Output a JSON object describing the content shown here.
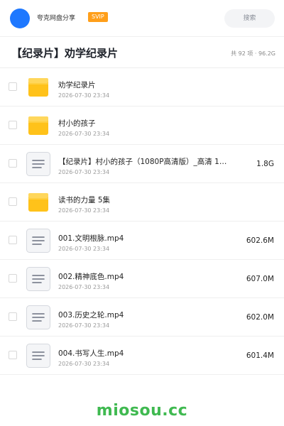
{
  "header": {
    "site_name": "夸克网盘分享",
    "badge": "SVIP",
    "search_label": "搜索",
    "avatar_color": "#1e78ff",
    "badge_color": "#ff9f1a"
  },
  "folder": {
    "title": "【纪录片】劝学纪录片",
    "summary": "共 92 项 · 96.2G"
  },
  "files": [
    {
      "type": "folder",
      "name": "劝学纪录片",
      "date": "2026-07-30 23:34",
      "size": ""
    },
    {
      "type": "folder",
      "name": "村小的孩子",
      "date": "2026-07-30 23:34",
      "size": ""
    },
    {
      "type": "file",
      "name": "【纪录片】村小的孩子（1080P高清版）_高清 1…",
      "date": "2026-07-30 23:34",
      "size": "1.8G"
    },
    {
      "type": "folder",
      "name": "读书的力量 5集",
      "date": "2026-07-30 23:34",
      "size": ""
    },
    {
      "type": "file",
      "name": "001.文明根脉.mp4",
      "date": "2026-07-30 23:34",
      "size": "602.6M"
    },
    {
      "type": "file",
      "name": "002.精神底色.mp4",
      "date": "2026-07-30 23:34",
      "size": "607.0M"
    },
    {
      "type": "file",
      "name": "003.历史之轮.mp4",
      "date": "2026-07-30 23:34",
      "size": "602.0M"
    },
    {
      "type": "file",
      "name": "004.书写人生.mp4",
      "date": "2026-07-30 23:34",
      "size": "601.4M"
    }
  ],
  "footer": {
    "brand": "miosou.cc",
    "brand_color": "#3fb950"
  },
  "icons": {
    "folder": "folder-icon",
    "file": "document-icon"
  }
}
